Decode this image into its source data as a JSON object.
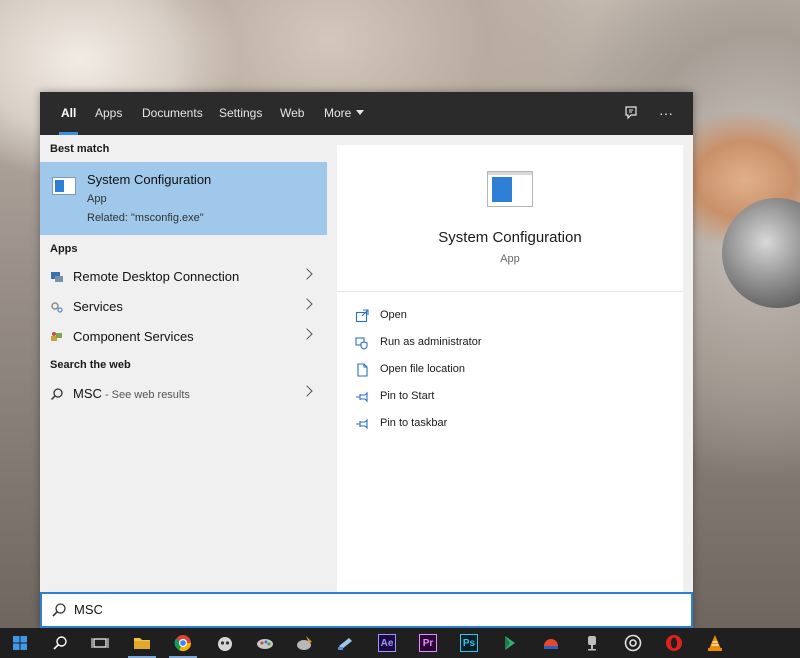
{
  "tabs": [
    {
      "label": "All",
      "active": true
    },
    {
      "label": "Apps"
    },
    {
      "label": "Documents"
    },
    {
      "label": "Settings"
    },
    {
      "label": "Web"
    },
    {
      "label": "More"
    }
  ],
  "header_icons": [
    "feedback-icon",
    "more-options-icon"
  ],
  "header_more_glyph": "···",
  "best_match": {
    "section_title": "Best match",
    "name": "System Configuration",
    "type": "App",
    "related": "Related: \"msconfig.exe\""
  },
  "apps": {
    "section_title": "Apps",
    "items": [
      {
        "label": "Remote Desktop Connection",
        "icon": "remote-desktop-icon"
      },
      {
        "label": "Services",
        "icon": "services-icon"
      },
      {
        "label": "Component Services",
        "icon": "component-services-icon"
      }
    ]
  },
  "web": {
    "section_title": "Search the web",
    "query": "MSC",
    "suffix": " - See web results"
  },
  "preview": {
    "name": "System Configuration",
    "type": "App",
    "actions": [
      {
        "label": "Open",
        "icon": "open-icon"
      },
      {
        "label": "Run as administrator",
        "icon": "shield-icon"
      },
      {
        "label": "Open file location",
        "icon": "file-location-icon"
      },
      {
        "label": "Pin to Start",
        "icon": "pin-icon"
      },
      {
        "label": "Pin to taskbar",
        "icon": "pin-icon"
      }
    ]
  },
  "search": {
    "value": "MSC"
  },
  "taskbar": {
    "items": [
      {
        "name": "start-button",
        "icon": "windows-logo-icon"
      },
      {
        "name": "search-button",
        "icon": "search-icon"
      },
      {
        "name": "task-view-button",
        "icon": "task-view-icon"
      },
      {
        "name": "file-explorer-button",
        "icon": "folder-icon"
      },
      {
        "name": "chrome-button",
        "icon": "chrome-icon"
      },
      {
        "name": "app-button-1",
        "icon": "app-icon"
      },
      {
        "name": "app-button-2",
        "icon": "app-icon"
      },
      {
        "name": "app-button-3",
        "icon": "app-icon"
      },
      {
        "name": "app-button-4",
        "icon": "app-icon"
      },
      {
        "name": "after-effects-button",
        "icon": "after-effects-icon",
        "label": "Ae"
      },
      {
        "name": "premiere-button",
        "icon": "premiere-icon",
        "label": "Pr"
      },
      {
        "name": "photoshop-button",
        "icon": "photoshop-icon",
        "label": "Ps"
      },
      {
        "name": "app-button-5",
        "icon": "app-icon"
      },
      {
        "name": "app-button-6",
        "icon": "app-icon"
      },
      {
        "name": "app-button-7",
        "icon": "app-icon"
      },
      {
        "name": "app-button-8",
        "icon": "app-icon"
      },
      {
        "name": "opera-button",
        "icon": "opera-icon"
      },
      {
        "name": "vlc-button",
        "icon": "vlc-icon"
      }
    ]
  }
}
